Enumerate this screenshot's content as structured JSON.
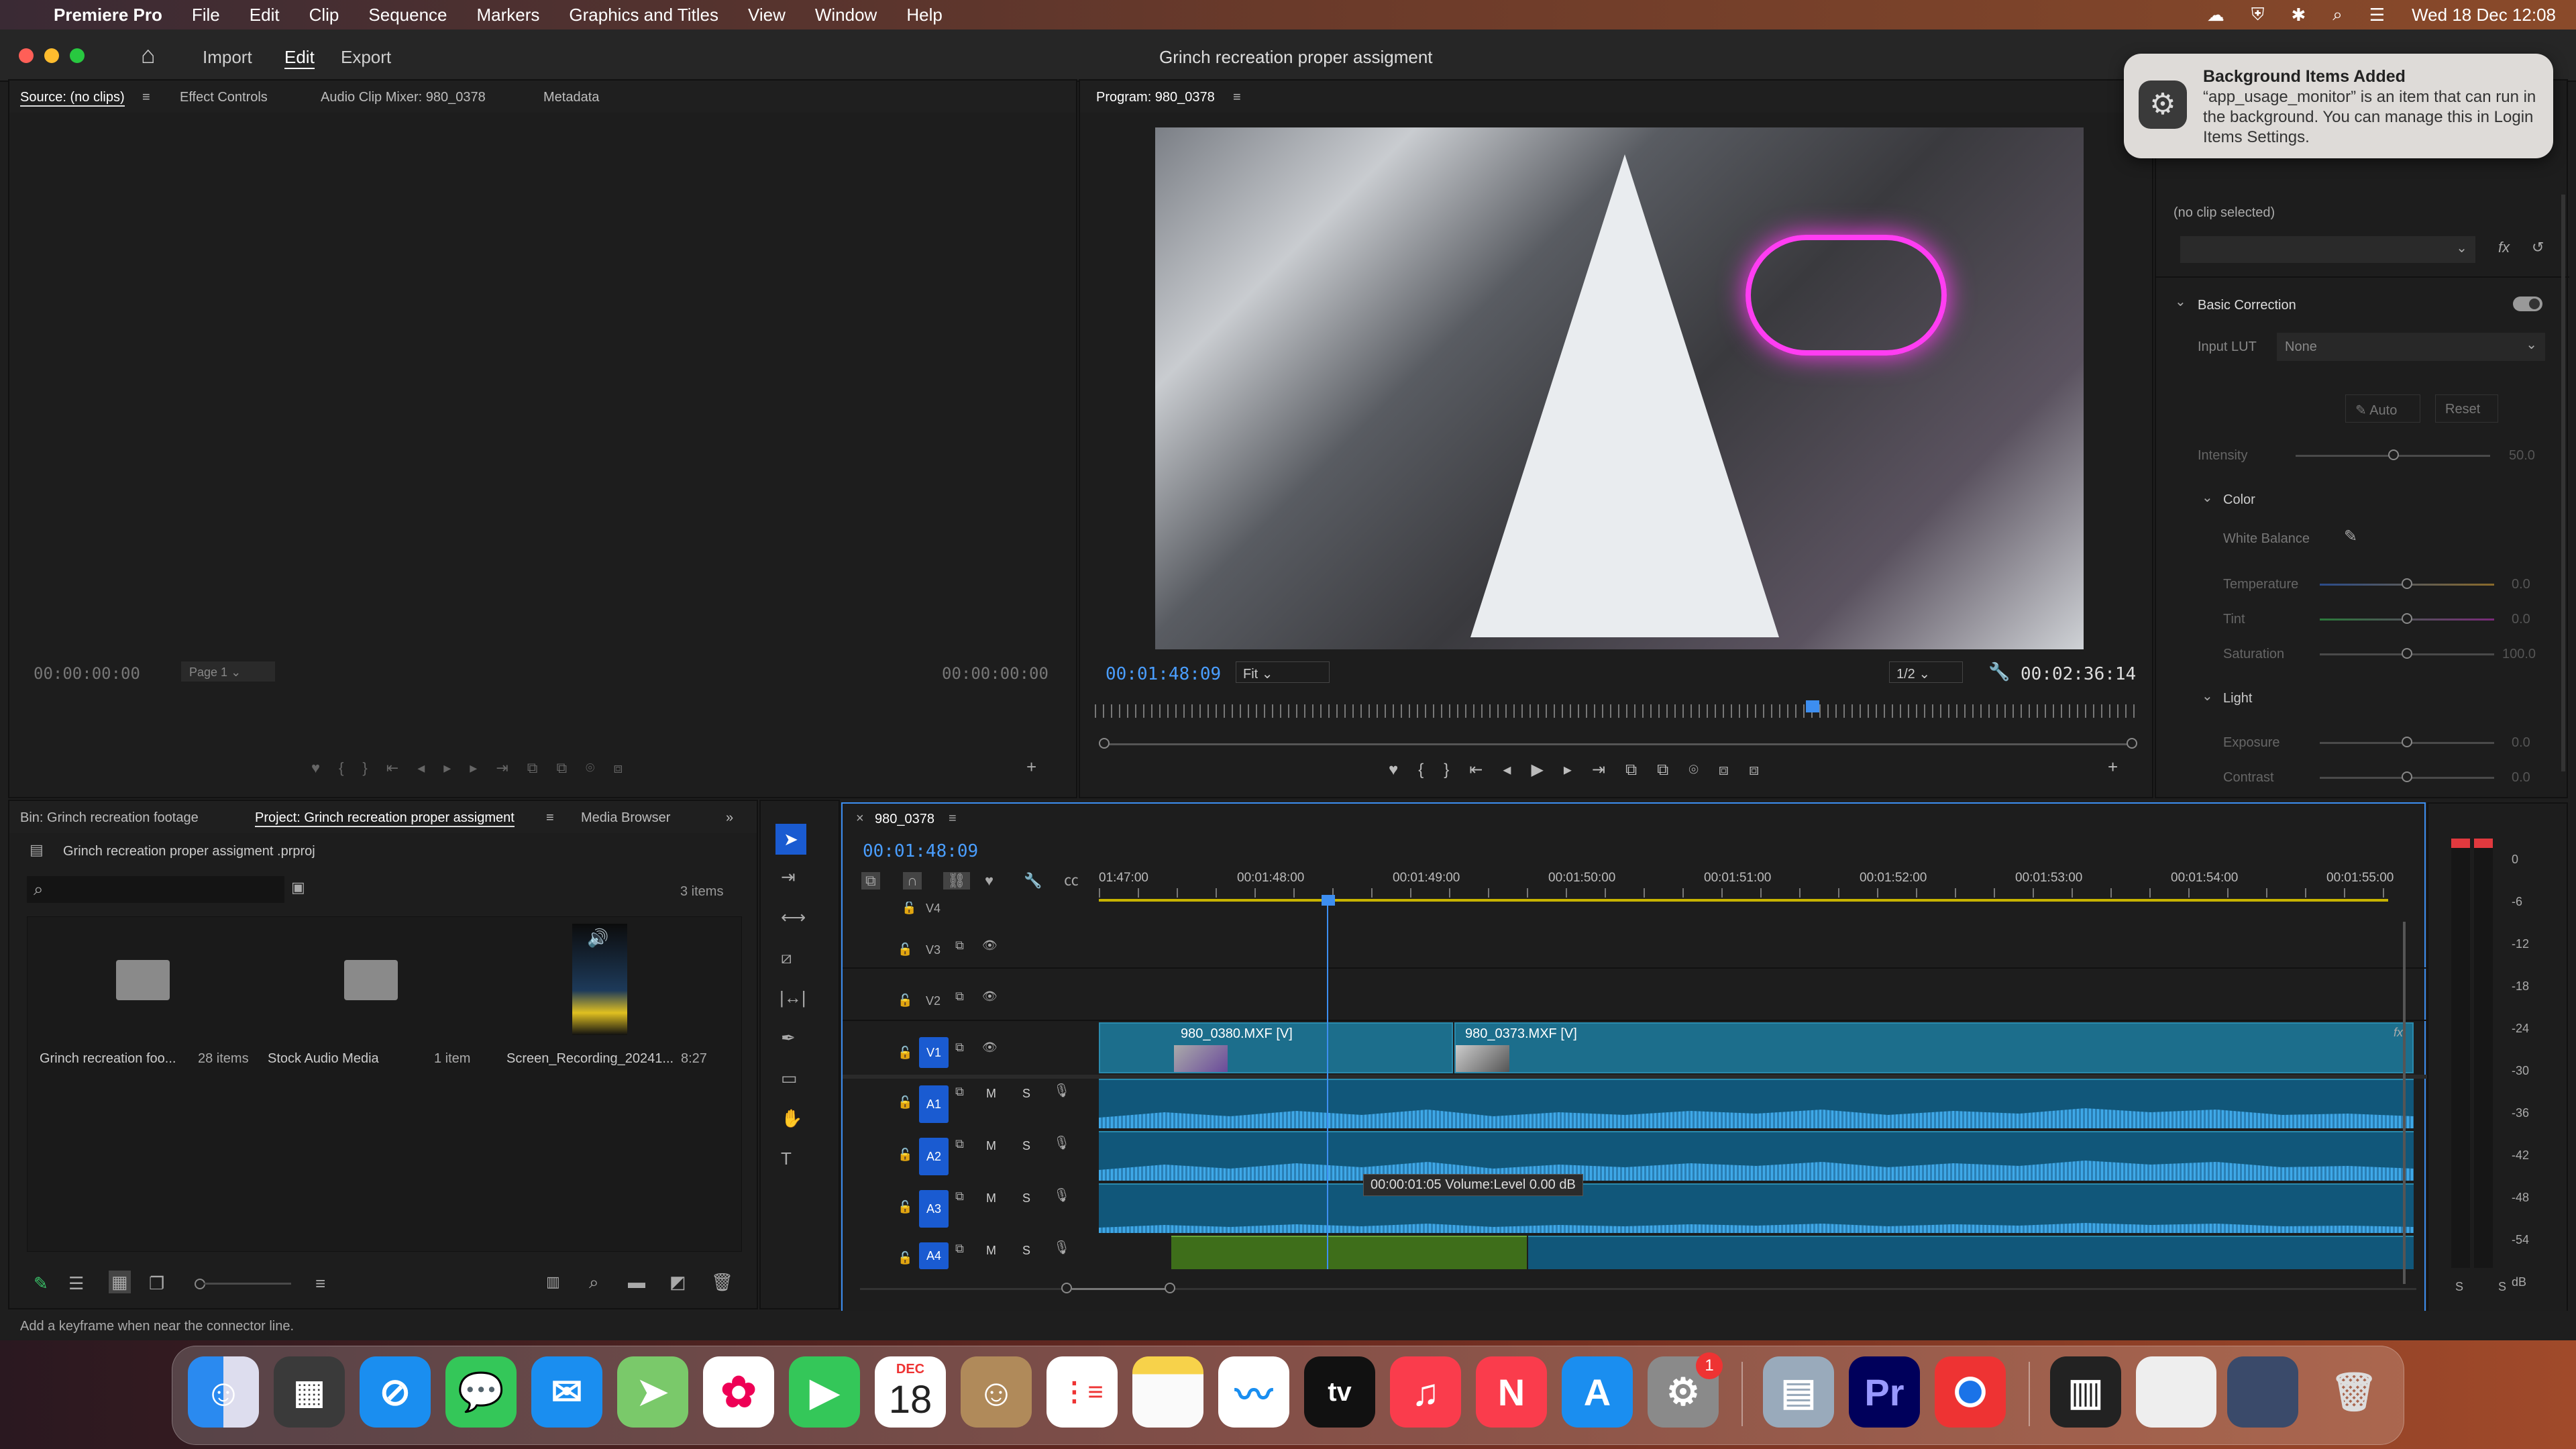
{
  "menubar": {
    "app": "Premiere Pro",
    "items": [
      "File",
      "Edit",
      "Clip",
      "Sequence",
      "Markers",
      "Graphics and Titles",
      "View",
      "Window",
      "Help"
    ],
    "datetime": "Wed 18 Dec  12:08"
  },
  "appbar": {
    "import": "Import",
    "edit": "Edit",
    "export": "Export",
    "title": "Grinch recreation proper  assigment"
  },
  "source": {
    "tabs": [
      "Source: (no clips)",
      "Effect Controls",
      "Audio Clip Mixer: 980_0378",
      "Metadata"
    ],
    "tc_left": "00:00:00:00",
    "page": "Page 1",
    "tc_right": "00:00:00:00"
  },
  "program": {
    "tab": "Program: 980_0378",
    "tc_current": "00:01:48:09",
    "fit": "Fit",
    "res": "1/2",
    "tc_duration": "00:02:36:14"
  },
  "notification": {
    "title": "Background Items Added",
    "body": "“app_usage_monitor” is an item that can run in the background. You can manage this in Login Items Settings."
  },
  "lumetri": {
    "no_clip": "(no clip selected)",
    "basic": "Basic Correction",
    "input_lut": "Input LUT",
    "lut_value": "None",
    "auto": "Auto",
    "reset": "Reset",
    "intensity": "Intensity",
    "intensity_val": "50.0",
    "color": "Color",
    "white_balance": "White Balance",
    "temperature": "Temperature",
    "temperature_val": "0.0",
    "tint": "Tint",
    "tint_val": "0.0",
    "saturation": "Saturation",
    "saturation_val": "100.0",
    "light": "Light",
    "exposure": "Exposure",
    "exposure_val": "0.0",
    "contrast": "Contrast",
    "contrast_val": "0.0"
  },
  "project": {
    "tabs": [
      "Bin: Grinch recreation footage",
      "Project: Grinch recreation proper  assigment",
      "Media Browser"
    ],
    "file": "Grinch recreation proper  assigment .prproj",
    "count": "3 items",
    "items": [
      {
        "name": "Grinch recreation foo...",
        "meta": "28 items"
      },
      {
        "name": "Stock Audio Media",
        "meta": "1 item"
      },
      {
        "name": "Screen_Recording_20241...",
        "meta": "8:27"
      }
    ]
  },
  "timeline": {
    "tab": "980_0378",
    "tc": "00:01:48:09",
    "ruler": [
      "01:47:00",
      "00:01:48:00",
      "00:01:49:00",
      "00:01:50:00",
      "00:01:51:00",
      "00:01:52:00",
      "00:01:53:00",
      "00:01:54:00",
      "00:01:55:00"
    ],
    "tracks_v": [
      "V4",
      "V3",
      "V2",
      "V1"
    ],
    "tracks_a": [
      "A1",
      "A2",
      "A3",
      "A4"
    ],
    "clip1": "980_0380.MXF [V]",
    "clip2": "980_0373.MXF [V]",
    "tooltip": "00:00:01:05  Volume:Level  0.00 dB",
    "mute": "M",
    "solo": "S"
  },
  "meter": {
    "scale": [
      "0",
      "-6",
      "-12",
      "-18",
      "-24",
      "-30",
      "-36",
      "-42",
      "-48",
      "-54",
      "dB"
    ],
    "s_labels": [
      "S",
      "S"
    ]
  },
  "status": "Add a keyframe when near the connector line.",
  "dock": {
    "date_month": "DEC",
    "date_day": "18",
    "badge": "1",
    "tv": "tv",
    "pr": "Pr"
  }
}
